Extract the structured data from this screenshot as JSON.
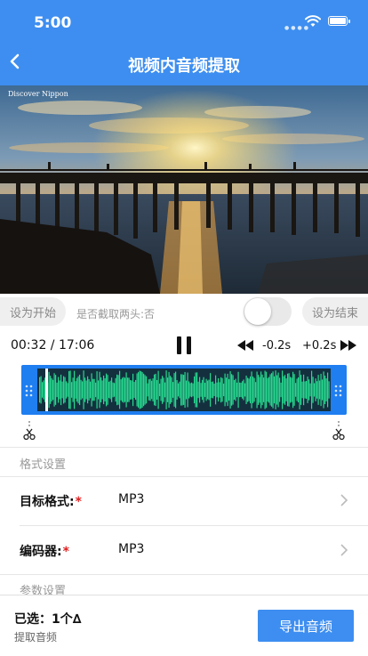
{
  "status_bar": {
    "time": "5:00"
  },
  "header": {
    "title": "视频内音频提取",
    "back_icon": "chevron-left-icon"
  },
  "video": {
    "watermark": "Discover Nippon"
  },
  "trim_controls": {
    "set_start_label": "设为开始",
    "trim_ends_label": "是否截取两头:否",
    "trim_ends_enabled": false,
    "set_end_label": "设为结束"
  },
  "playback": {
    "timecode": "00:32 / 17:06",
    "state": "playing",
    "step_back_label": "-0.2s",
    "step_forward_label": "+0.2s",
    "playhead_fraction": 0.03
  },
  "colors": {
    "accent": "#3d8ef0",
    "waveform": "#27d88e",
    "waveform_bg": "#14303f",
    "required": "#e02020"
  },
  "format_settings": {
    "section_label": "格式设置",
    "target_format": {
      "label": "目标格式:",
      "required_mark": "*",
      "value": "MP3"
    },
    "encoder": {
      "label": "编码器:",
      "required_mark": "*",
      "value": "MP3"
    }
  },
  "param_settings": {
    "section_label": "参数设置"
  },
  "footer": {
    "selected_text": "已选：1个∆",
    "subtitle": "提取音频",
    "export_label": "导出音频"
  }
}
